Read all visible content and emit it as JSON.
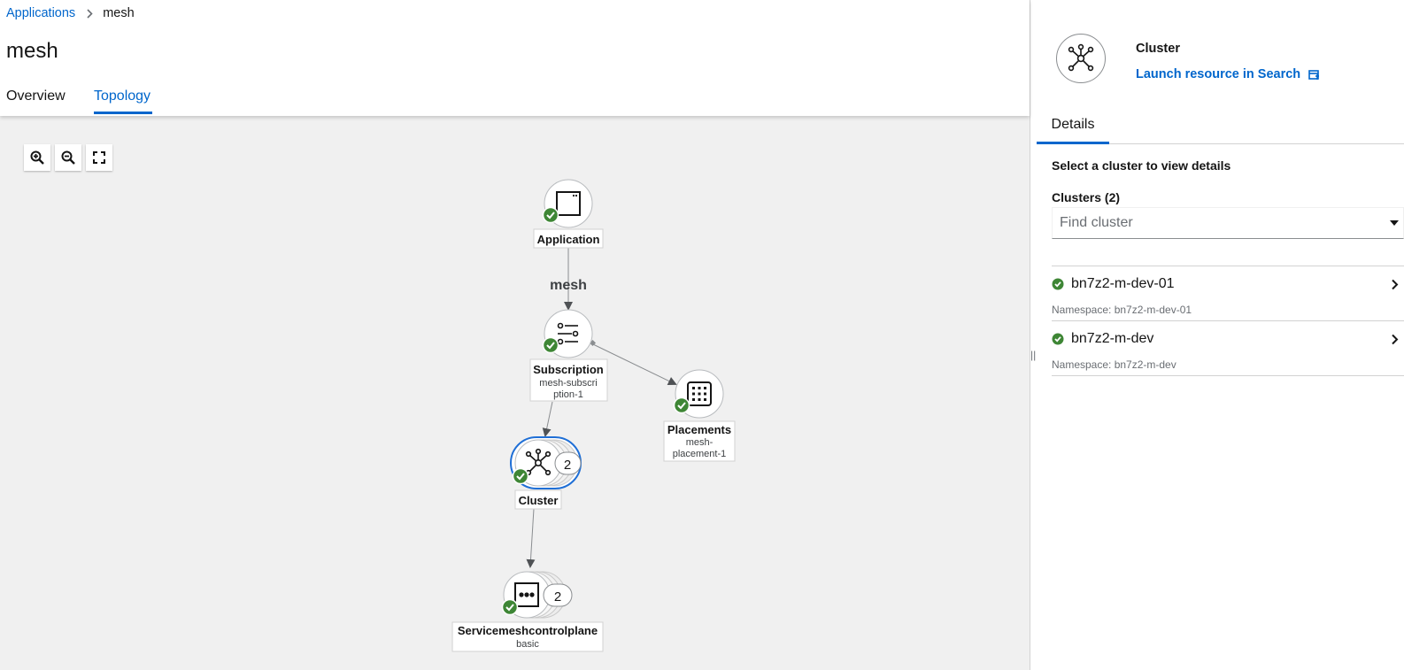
{
  "breadcrumb": {
    "parent": "Applications",
    "current": "mesh"
  },
  "page": {
    "title": "mesh"
  },
  "tabs": [
    {
      "label": "Overview",
      "active": false
    },
    {
      "label": "Topology",
      "active": true
    }
  ],
  "zoom": {
    "zoom_in": "zoom-in-icon",
    "zoom_out": "zoom-out-icon",
    "fit": "expand-icon"
  },
  "topology": {
    "edge_label": "mesh",
    "nodes": {
      "application": {
        "title": "Application"
      },
      "subscription": {
        "title": "Subscription",
        "subtitle1": "mesh-subscri",
        "subtitle2": "ption-1"
      },
      "placements": {
        "title": "Placements",
        "subtitle1": "mesh-",
        "subtitle2": "placement-1"
      },
      "cluster": {
        "title": "Cluster",
        "count": "2"
      },
      "smcp": {
        "title": "Servicemeshcontrolplane",
        "subtitle1": "basic",
        "count": "2"
      }
    }
  },
  "panel": {
    "title": "Cluster",
    "link": "Launch resource in Search",
    "tab": "Details",
    "select_msg": "Select a cluster to view details",
    "clusters_label": "Clusters (2)",
    "find_placeholder": "Find cluster",
    "clusters": [
      {
        "name": "bn7z2-m-dev-01",
        "namespace": "Namespace: bn7z2-m-dev-01"
      },
      {
        "name": "bn7z2-m-dev",
        "namespace": "Namespace: bn7z2-m-dev"
      }
    ]
  },
  "colors": {
    "accent": "#0066cc",
    "success": "#3e8635",
    "canvas": "#f0f0f0"
  }
}
